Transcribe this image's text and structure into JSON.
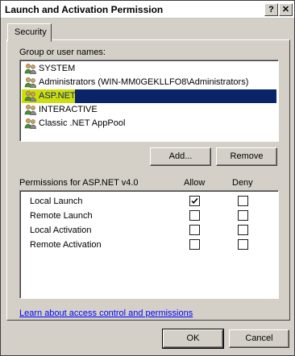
{
  "window": {
    "title": "Launch and Activation Permission",
    "help_glyph": "?",
    "close_glyph": "✕"
  },
  "tabs": [
    {
      "label": "Security"
    }
  ],
  "group": {
    "label": "Group or user names:",
    "items": [
      {
        "name": "SYSTEM",
        "icon": "user-group-icon"
      },
      {
        "name": "Administrators (WIN-MM0GEKLLFO8\\Administrators)",
        "icon": "user-group-icon"
      },
      {
        "name": "ASP.NET v4.0",
        "icon": "user-group-icon",
        "selected": true
      },
      {
        "name": "INTERACTIVE",
        "icon": "user-group-icon"
      },
      {
        "name": "Classic .NET AppPool",
        "icon": "user-group-icon"
      }
    ],
    "add_label": "Add...",
    "remove_label": "Remove"
  },
  "permissions": {
    "header": "Permissions for ASP.NET v4.0",
    "allow_label": "Allow",
    "deny_label": "Deny",
    "rows": [
      {
        "name": "Local Launch",
        "allow": true,
        "deny": false
      },
      {
        "name": "Remote Launch",
        "allow": false,
        "deny": false
      },
      {
        "name": "Local Activation",
        "allow": false,
        "deny": false
      },
      {
        "name": "Remote Activation",
        "allow": false,
        "deny": false
      }
    ]
  },
  "link_text": "Learn about access control and permissions",
  "footer": {
    "ok_label": "OK",
    "cancel_label": "Cancel"
  },
  "colors": {
    "selection": "#0a246a",
    "highlight": "#f0ff00",
    "link": "#0000ff",
    "face": "#d4d0c8"
  }
}
